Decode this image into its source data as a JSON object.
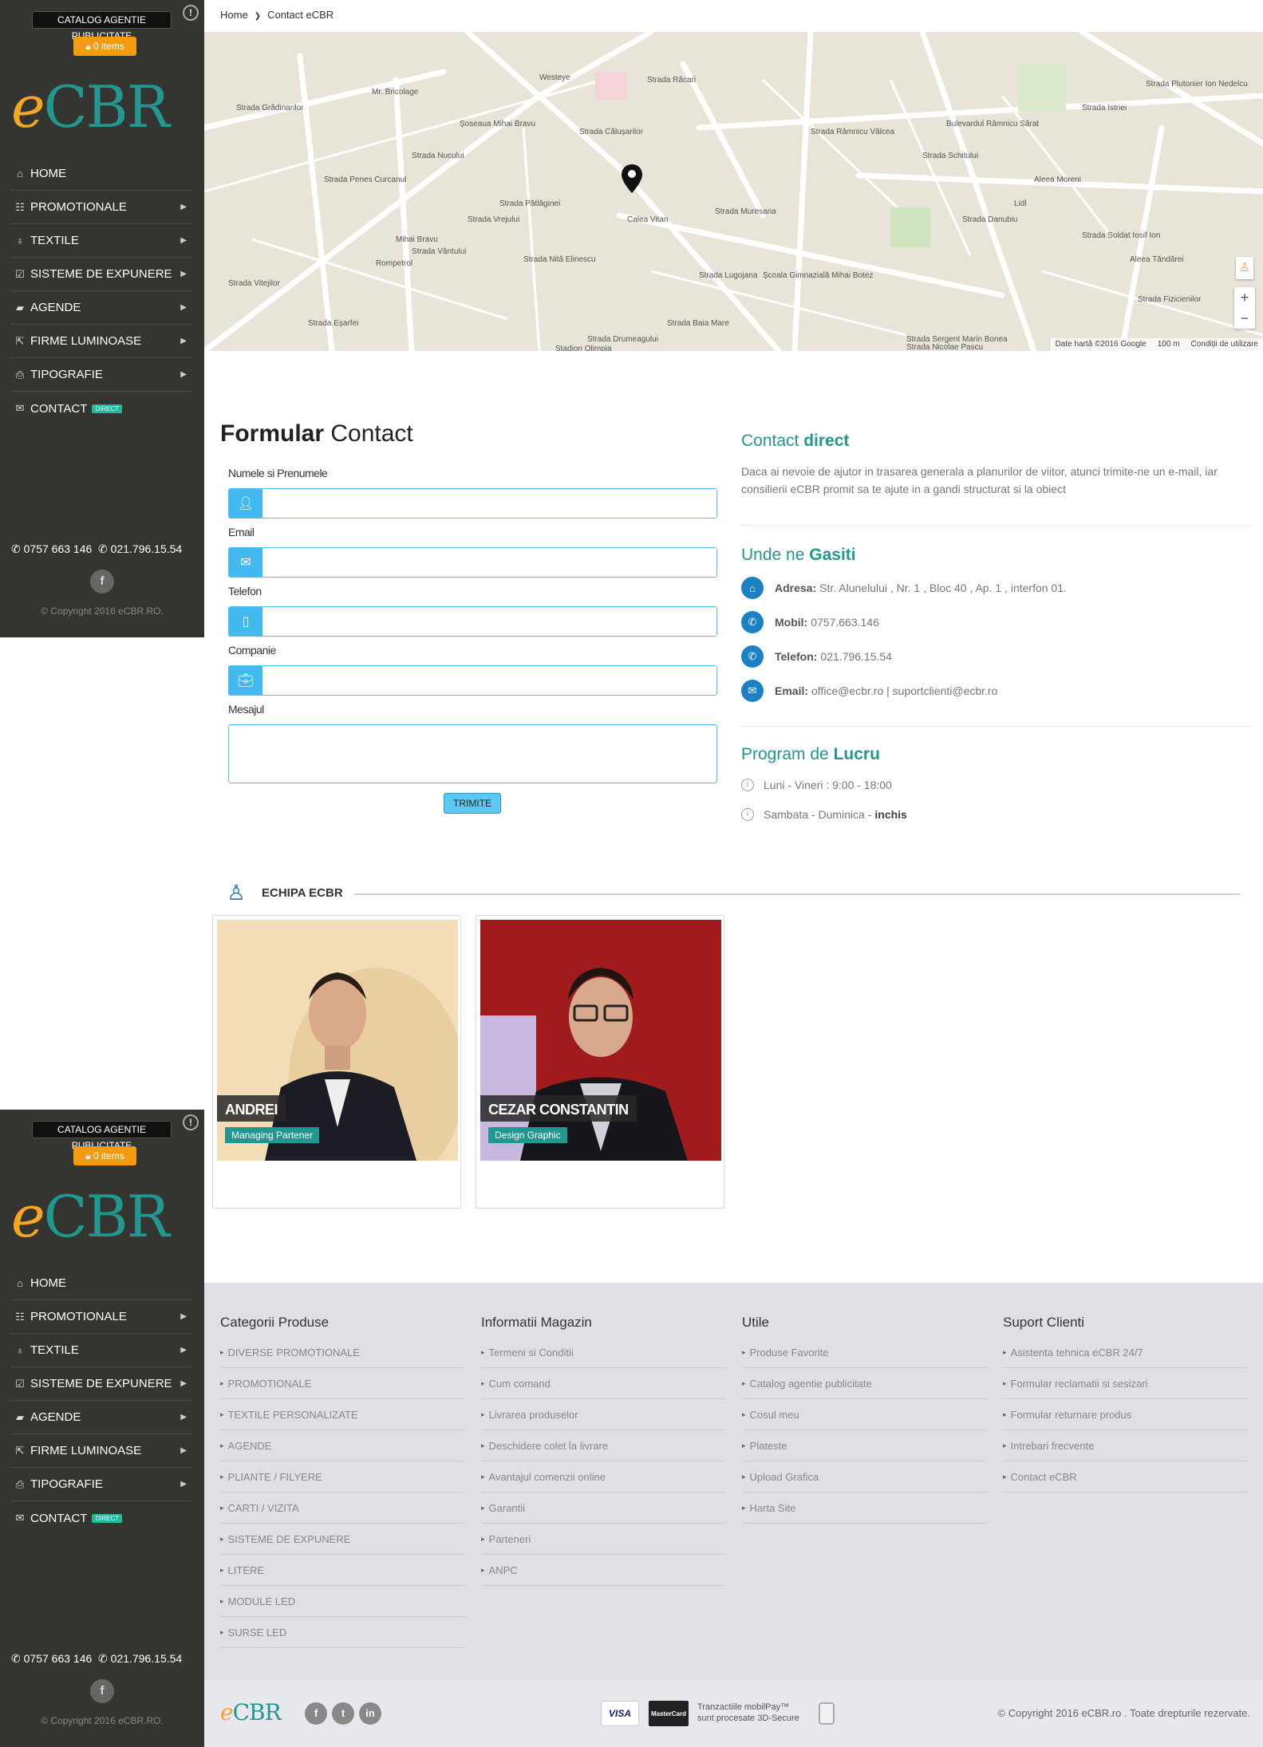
{
  "sidebar": {
    "catalog_label": "CATALOG AGENTIE PUBLICITATE",
    "cart_label": "0 items",
    "logo_e": "e",
    "logo_rest": "CBR",
    "nav": [
      {
        "label": "HOME",
        "icon": "home-icon"
      },
      {
        "label": "PROMOTIONALE",
        "icon": "grid-icon"
      },
      {
        "label": "TEXTILE",
        "icon": "needle-icon"
      },
      {
        "label": "SISTEME DE EXPUNERE",
        "icon": "checkbox-icon"
      },
      {
        "label": "AGENDE",
        "icon": "book-icon"
      },
      {
        "label": "FIRME LUMINOASE",
        "icon": "external-link-icon"
      },
      {
        "label": "TIPOGRAFIE",
        "icon": "printer-icon"
      },
      {
        "label": "CONTACT",
        "icon": "envelope-icon",
        "badge": "DIRECT"
      }
    ],
    "phone1": "0757 663 146",
    "phone2": "021.796.15.54",
    "copyright": "© Copyright 2016 eCBR.RO."
  },
  "breadcrumb": {
    "home": "Home",
    "current": "Contact eCBR"
  },
  "map": {
    "attribution": "Date hartă ©2016 Google",
    "scale": "100 m",
    "terms": "Condiții de utilizare",
    "labels": [
      "Strada Grădinarilor",
      "Mr. Bricolage",
      "Westeye",
      "Strada Călușarilor",
      "Strada Râcari",
      "Strada Istriei",
      "Strada Plutonier Ion Nedelcu",
      "Strada Nucului",
      "Strada Pătlăginei",
      "Strada Vrejului",
      "Strada Vântului",
      "Strada Nită Elinescu",
      "Calea Vitan",
      "Strada Schitului",
      "Strada Danubiu",
      "Aleea Moreni",
      "Strada Soldat Iosif Ion",
      "Aleea Tăndărei",
      "Mihai Bravu",
      "Rompetrol",
      "Strada Vitejilor",
      "Strada Eșarfei",
      "Școala Gimnazială Mihai Botez",
      "Strada Baia Mare",
      "Strada Sergent Marin Bonea",
      "Strada Nicolae Pascu",
      "Strada Fizicienilor",
      "Lidl",
      "Bulevardul Râmnicu Sărat",
      "Strada Muresana",
      "Strada Lugojana",
      "Șoseaua Mihai Bravu",
      "Strada Drumeagului",
      "Strada Penes Curcanul",
      "Stadion Olimpia",
      "Strada Râmnicu Vâlcea"
    ]
  },
  "form": {
    "title_bold": "Formular",
    "title_light": "Contact",
    "fields": [
      {
        "label": "Numele si Prenumele",
        "value": "",
        "icon": "user-icon"
      },
      {
        "label": "Email",
        "value": "",
        "icon": "envelope-icon"
      },
      {
        "label": "Telefon",
        "value": "",
        "icon": "mobile-icon"
      },
      {
        "label": "Companie",
        "value": "",
        "icon": "briefcase-icon"
      }
    ],
    "message_label": "Mesajul",
    "message_value": "",
    "submit_label": "TRIMITE"
  },
  "contact": {
    "title_light": "Contact",
    "title_bold": "direct",
    "text": "Daca ai nevoie de ajutor in trasarea generala a planurilor de viitor, atunci trimite-ne un e-mail, iar consilierii eCBR promit sa te ajute in a gandi structurat si la obiect",
    "where_light": "Unde ne",
    "where_bold": "Gasiti",
    "rows": [
      {
        "label": "Adresa:",
        "value": "Str. Alunelului , Nr. 1 , Bloc 40 , Ap. 1 , interfon 01.",
        "icon": "home-icon"
      },
      {
        "label": "Mobil:",
        "value": "0757.663.146",
        "icon": "phone-icon"
      },
      {
        "label": "Telefon:",
        "value": "021.796.15.54",
        "icon": "phone-icon"
      },
      {
        "label": "Email:",
        "value": "office@ecbr.ro | suportclienti@ecbr.ro",
        "icon": "envelope-icon"
      }
    ],
    "program_light": "Program de",
    "program_bold": "Lucru",
    "program1": "Luni - Vineri : 9:00 - 18:00",
    "program2_text": "Sambata - Duminica -",
    "program2_bold": "inchis"
  },
  "team": {
    "title": "ECHIPA ECBR",
    "members": [
      {
        "name": "ANDREI",
        "role": "Managing Partener"
      },
      {
        "name": "CEZAR CONSTANTIN",
        "role": "Design Graphic"
      }
    ]
  },
  "footer": {
    "columns": [
      {
        "title": "Categorii Produse",
        "items": [
          "DIVERSE PROMOTIONALE",
          "PROMOTIONALE",
          "TEXTILE PERSONALIZATE",
          "AGENDE",
          "PLIANTE / FILYERE",
          "CARTI / VIZITA",
          "SISTEME DE EXPUNERE",
          "LITERE",
          "MODULE LED",
          "SURSE LED"
        ]
      },
      {
        "title": "Informatii Magazin",
        "items": [
          "Termeni si Conditii",
          "Cum comand",
          "Livrarea produselor",
          "Deschidere colet la livrare",
          "Avantajul comenzii online",
          "Garantii",
          "Parteneri",
          "ANPC"
        ]
      },
      {
        "title": "Utile",
        "items": [
          "Produse Favorite",
          "Catalog agentie publicitate",
          "Cosul meu",
          "Plateste",
          "Upload Grafica",
          "Harta Site"
        ]
      },
      {
        "title": "Suport Clienti",
        "items": [
          "Asistenta tehnica eCBR 24/7",
          "Formular reclamatii si sesizari",
          "Formular returnare produs",
          "Intrebari frecvente",
          "Contact eCBR"
        ]
      }
    ]
  },
  "bottom": {
    "visa": "VISA",
    "mastercard": "MasterCard",
    "mobilpay_line1": "Tranzactiile mobilPay™",
    "mobilpay_line2": "sunt procesate 3D-Secure",
    "copyright": "© Copyright 2016 eCBR.ro . Toate drepturile rezervate."
  }
}
